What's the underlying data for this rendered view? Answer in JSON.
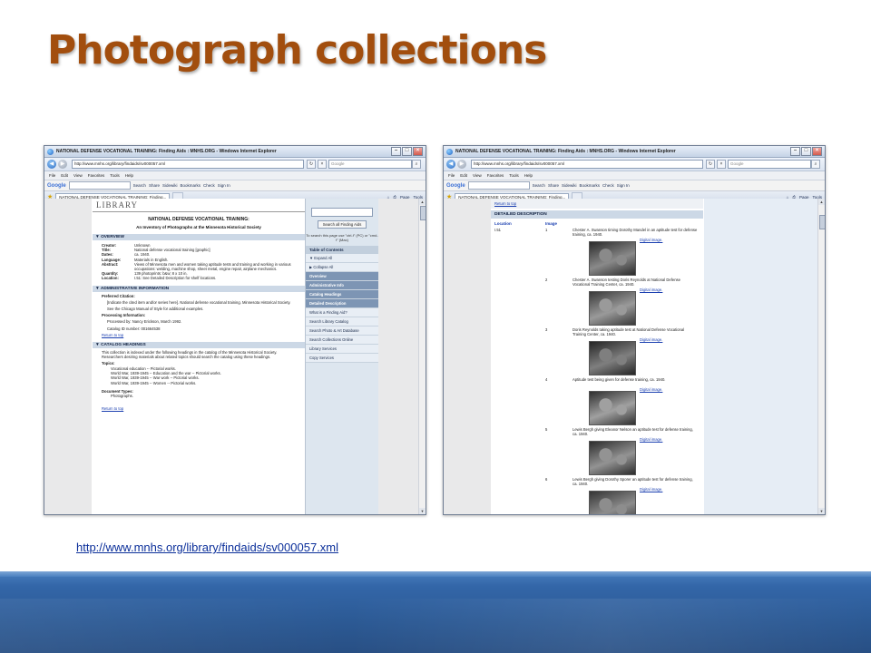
{
  "slide": {
    "title": "Photograph collections",
    "link": "http://www.mnhs.org/library/findaids/sv000057.xml"
  },
  "browser": {
    "window_title": "NATIONAL DEFENSE VOCATIONAL TRAINING: Finding Aids : MNHS.ORG - Windows Internet Explorer",
    "address": "http://www.mnhs.org/library/findaids/sv000057.xml",
    "search_placeholder": "Google",
    "menu": [
      "File",
      "Edit",
      "View",
      "Favorites",
      "Tools",
      "Help"
    ],
    "google_toolbar": [
      "Search",
      "Share",
      "Sidewiki",
      "Bookmarks",
      "Check",
      "Sign In"
    ],
    "tab_label": "NATIONAL DEFENSE VOCATIONAL TRAINING: Finding...",
    "tab_tools": [
      "Page",
      "Tools"
    ]
  },
  "left_page": {
    "header": "LIBRARY",
    "title": "NATIONAL DEFENSE VOCATIONAL TRAINING:",
    "subtitle": "An Inventory of Photographs at the Minnesota Historical Society",
    "overview_head": "▼ OVERVIEW",
    "overview": [
      {
        "k": "Creator:",
        "v": "Unknown"
      },
      {
        "k": "Title:",
        "v": "National defense vocational training [graphic]"
      },
      {
        "k": "Dates:",
        "v": "ca. 1940."
      },
      {
        "k": "Language:",
        "v": "Materials in English."
      },
      {
        "k": "Abstract:",
        "v": "Views of Minnesota men and women taking aptitude tests and training and working in various occupations: welding, machine shop, sheet metal, engine repair, airplane mechanics."
      },
      {
        "k": "Quantity:",
        "v": "139 photoprints: b&w; 8 x 10 in."
      },
      {
        "k": "Location:",
        "v": "I.51: See Detailed Description for shelf locations."
      }
    ],
    "admin_head": "▼ ADMINISTRATIVE INFORMATION",
    "preferred_citation": "Preferred Citation:",
    "citation_text": "[Indicate the cited item and/or series here]. National defense vocational training. Minnesota Historical Society.",
    "citation_note": "See the Chicago Manual of Style for additional examples.",
    "processing_info": "Processing Information:",
    "processed_by": "Processed by: Nancy Erickson, March 1992.",
    "catalog_id": "Catalog ID number: 001664538",
    "return_top": "Return to top",
    "catalog_head": "▼ CATALOG HEADINGS",
    "catalog_text": "This collection is indexed under the following headings in the catalog of the Minnesota Historical Society. Researchers desiring materials about related topics should search the catalog using these headings.",
    "topics_label": "Topics:",
    "topics": [
      "Vocational education -- Pictorial works.",
      "World War, 1939-1945 -- Education and the war -- Pictorial works.",
      "World War, 1939-1945 -- War work -- Pictorial works.",
      "World War, 1939-1945 -- Women -- Pictorial works."
    ],
    "doc_types_label": "Document Types:",
    "doc_types": "Photographs.",
    "return_top2": "Return to top"
  },
  "left_side": {
    "search_button": "Search all Finding Aids",
    "note": "To search this page use \"ctrl-f\" (PC) or \"cmd-f\" (Mac)",
    "toc": "Table of Contents",
    "items": [
      {
        "label": "▼ Expand All",
        "style": "plain"
      },
      {
        "label": "▶ Collapse All",
        "style": "plain"
      },
      {
        "label": "Overview",
        "style": "dark"
      },
      {
        "label": "Administrative Info",
        "style": "dark"
      },
      {
        "label": "Catalog Headings",
        "style": "dark"
      },
      {
        "label": "Detailed Description",
        "style": "dark"
      },
      {
        "label": "What is a Finding Aid?",
        "style": "plain"
      },
      {
        "label": "Search Library Catalog",
        "style": "plain"
      },
      {
        "label": "Search Photo & Art Database",
        "style": "plain"
      },
      {
        "label": "Search Collections Online",
        "style": "plain"
      },
      {
        "label": "Library Services",
        "style": "plain"
      },
      {
        "label": "Copy Services",
        "style": "plain"
      }
    ]
  },
  "right_page": {
    "return_top": "Return to top",
    "head": "DETAILED DESCRIPTION",
    "col_location": "Location",
    "col_image": "Image",
    "link_text": "Digital image.",
    "rows": [
      {
        "loc": "I.51",
        "num": "1",
        "desc": "Chester A. Swanson timing Dorothy Mandel in an aptitude test for defense training, ca. 1940."
      },
      {
        "loc": "",
        "num": "2",
        "desc": "Chester A. Swanson testing Doris Reynolds at National Defense Vocational Training Center, ca. 1940."
      },
      {
        "loc": "",
        "num": "3",
        "desc": "Doris Reynolds taking aptitude test at National Defense Vocational Training Center, ca. 1940."
      },
      {
        "loc": "",
        "num": "4",
        "desc": "Aptitude test being given for defense training, ca. 1940."
      },
      {
        "loc": "",
        "num": "5",
        "desc": "Lewis Bergh giving Eleanor Nelson an aptitude test for defense training, ca. 1940."
      },
      {
        "loc": "",
        "num": "6",
        "desc": "Lewis Bergh giving Dorothy Sporer an aptitude test for defense training, ca. 1940."
      }
    ]
  }
}
